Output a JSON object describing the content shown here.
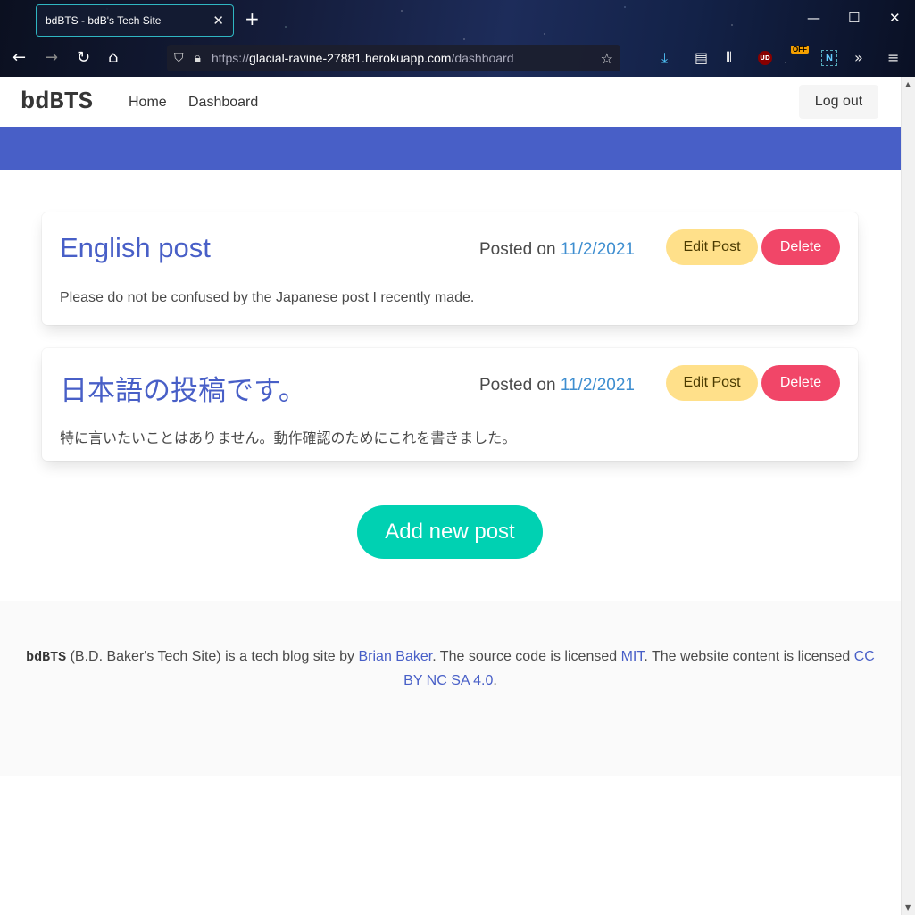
{
  "browser": {
    "tab_title": "bdBTS - bdB's Tech Site",
    "url_prefix": "https://",
    "url_host": "glacial-ravine-27881.herokuapp.com",
    "url_path": "/dashboard",
    "ublock_badge": "UD",
    "off_badge": "OFF",
    "n_badge": "N"
  },
  "navbar": {
    "brand": "bdBTS",
    "links": [
      "Home",
      "Dashboard"
    ],
    "logout_label": "Log out"
  },
  "posts": [
    {
      "title": "English post",
      "posted_prefix": "Posted on",
      "date": "11/2/2021",
      "edit_label": "Edit Post",
      "delete_label": "Delete",
      "body": "Please do not be confused by the Japanese post I recently made."
    },
    {
      "title": "日本語の投稿です。",
      "posted_prefix": "Posted on",
      "date": "11/2/2021",
      "edit_label": "Edit Post",
      "delete_label": "Delete",
      "body": "特に言いたいことはありません。動作確認のためにこれを書きました。"
    }
  ],
  "add_post_label": "Add new post",
  "footer": {
    "brand": "bdBTS",
    "text1": " (B.D. Baker's Tech Site) is a tech blog site by ",
    "author": "Brian Baker",
    "text2": ". The source code is licensed ",
    "license_code": "MIT",
    "text3": ". The website content is licensed ",
    "license_content": "CC BY NC SA 4.0",
    "text4": "."
  },
  "colors": {
    "primary": "#485fc7",
    "hero": "#485fc7",
    "edit": "#ffe08a",
    "delete": "#f14668",
    "add": "#00d1b2",
    "date_link": "#3e8ed0"
  }
}
